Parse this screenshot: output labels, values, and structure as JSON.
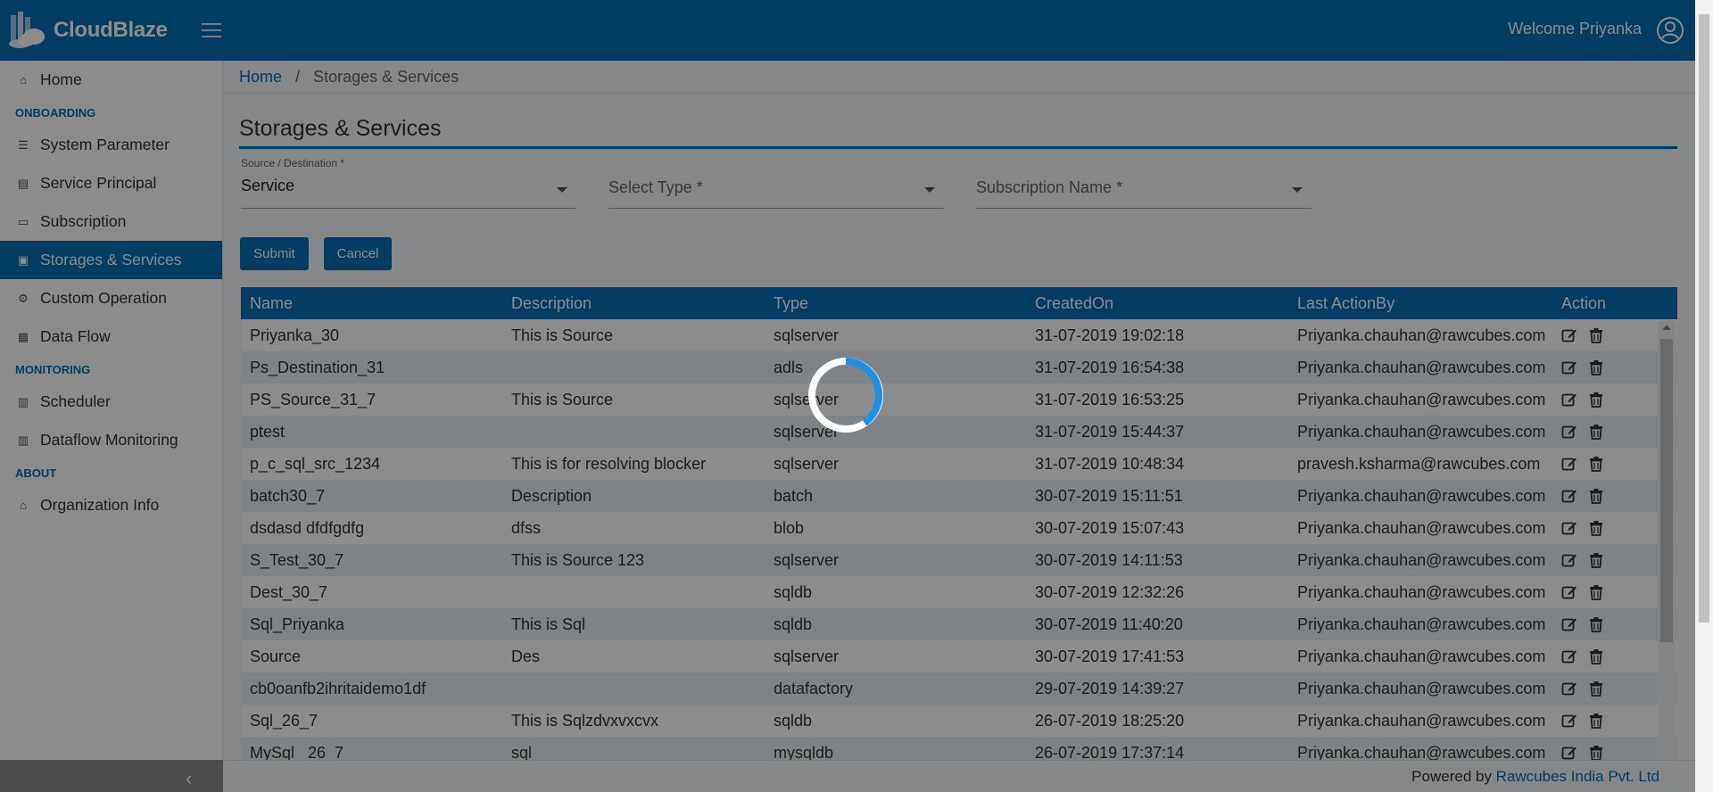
{
  "app": {
    "name": "CloudBlaze",
    "welcome": "Welcome Priyanka"
  },
  "sidebar": {
    "items": [
      {
        "label": "Home",
        "icon": "home-icon"
      },
      {
        "section": "ONBOARDING"
      },
      {
        "label": "System Parameter",
        "icon": "sliders-icon"
      },
      {
        "label": "Service Principal",
        "icon": "files-icon"
      },
      {
        "label": "Subscription",
        "icon": "id-card-icon"
      },
      {
        "label": "Storages & Services",
        "icon": "storage-icon",
        "active": true
      },
      {
        "label": "Custom Operation",
        "icon": "cogs-icon"
      },
      {
        "label": "Data Flow",
        "icon": "table-icon"
      },
      {
        "section": "MONITORING"
      },
      {
        "label": "Scheduler",
        "icon": "calendar-icon"
      },
      {
        "label": "Dataflow Monitoring",
        "icon": "calendar-icon"
      },
      {
        "section": "ABOUT"
      },
      {
        "label": "Organization Info",
        "icon": "bank-icon"
      }
    ]
  },
  "breadcrumb": {
    "home": "Home",
    "sep": "/",
    "current": "Storages & Services"
  },
  "page": {
    "title": "Storages & Services"
  },
  "form": {
    "source_label": "Source / Destination *",
    "source_value": "Service",
    "type_placeholder": "Select Type *",
    "subscription_placeholder": "Subscription Name *",
    "submit": "Submit",
    "cancel": "Cancel"
  },
  "table": {
    "columns": [
      "Name",
      "Description",
      "Type",
      "CreatedOn",
      "Last ActionBy",
      "Action"
    ],
    "rows": [
      [
        "Priyanka_30",
        "This is Source",
        "sqlserver",
        "31-07-2019 19:02:18",
        "Priyanka.chauhan@rawcubes.com"
      ],
      [
        "Ps_Destination_31",
        "",
        "adls",
        "31-07-2019 16:54:38",
        "Priyanka.chauhan@rawcubes.com"
      ],
      [
        "PS_Source_31_7",
        "This is Source",
        "sqlserver",
        "31-07-2019 16:53:25",
        "Priyanka.chauhan@rawcubes.com"
      ],
      [
        "ptest",
        "",
        "sqlserver",
        "31-07-2019 15:44:37",
        "Priyanka.chauhan@rawcubes.com"
      ],
      [
        "p_c_sql_src_1234",
        "This is for resolving blocker",
        "sqlserver",
        "31-07-2019 10:48:34",
        "pravesh.ksharma@rawcubes.com"
      ],
      [
        "batch30_7",
        "Description",
        "batch",
        "30-07-2019 15:11:51",
        "Priyanka.chauhan@rawcubes.com"
      ],
      [
        "dsdasd dfdfgdfg",
        "dfss",
        "blob",
        "30-07-2019 15:07:43",
        "Priyanka.chauhan@rawcubes.com"
      ],
      [
        "S_Test_30_7",
        "This is Source 123",
        "sqlserver",
        "30-07-2019 14:11:53",
        "Priyanka.chauhan@rawcubes.com"
      ],
      [
        "Dest_30_7",
        "",
        "sqldb",
        "30-07-2019 12:32:26",
        "Priyanka.chauhan@rawcubes.com"
      ],
      [
        "Sql_Priyanka",
        "This is Sql",
        "sqldb",
        "30-07-2019 11:40:20",
        "Priyanka.chauhan@rawcubes.com"
      ],
      [
        "Source",
        "Des",
        "sqlserver",
        "30-07-2019 17:41:53",
        "Priyanka.chauhan@rawcubes.com"
      ],
      [
        "cb0oanfb2ihritaidemo1df",
        "",
        "datafactory",
        "29-07-2019 14:39:27",
        "Priyanka.chauhan@rawcubes.com"
      ],
      [
        "Sql_26_7",
        "This is Sqlzdvxvxcvx",
        "sqldb",
        "26-07-2019 18:25:20",
        "Priyanka.chauhan@rawcubes.com"
      ],
      [
        "MySql _26_7",
        "sql",
        "mysqldb",
        "26-07-2019 17:37:14",
        "Priyanka.chauhan@rawcubes.com"
      ]
    ]
  },
  "footer": {
    "prefix": "Powered by ",
    "link": "Rawcubes India Pvt. Ltd"
  },
  "colors": {
    "primary": "#0270b5",
    "spinner_accent": "#1e90e6"
  }
}
